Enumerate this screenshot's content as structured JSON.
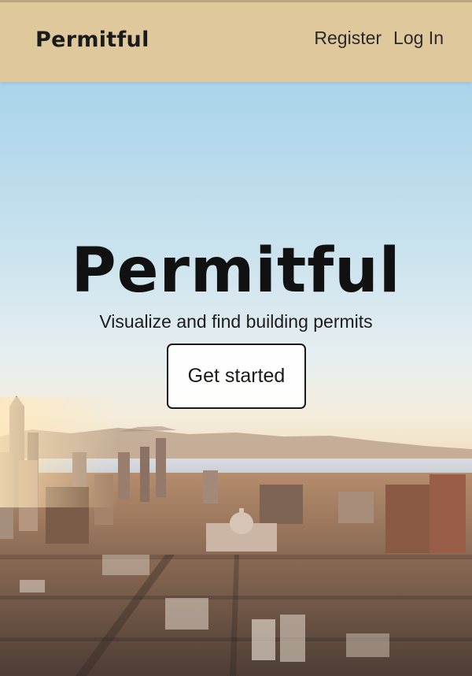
{
  "header": {
    "brand": "Permitful",
    "nav": {
      "register": "Register",
      "login": "Log In"
    }
  },
  "hero": {
    "title": "Permitful",
    "subtitle": "Visualize and find building permits",
    "cta_label": "Get started"
  },
  "colors": {
    "header_bg": "#dfc99c",
    "text": "#111111",
    "button_border": "#1a1a1a",
    "button_bg": "#ffffff"
  }
}
